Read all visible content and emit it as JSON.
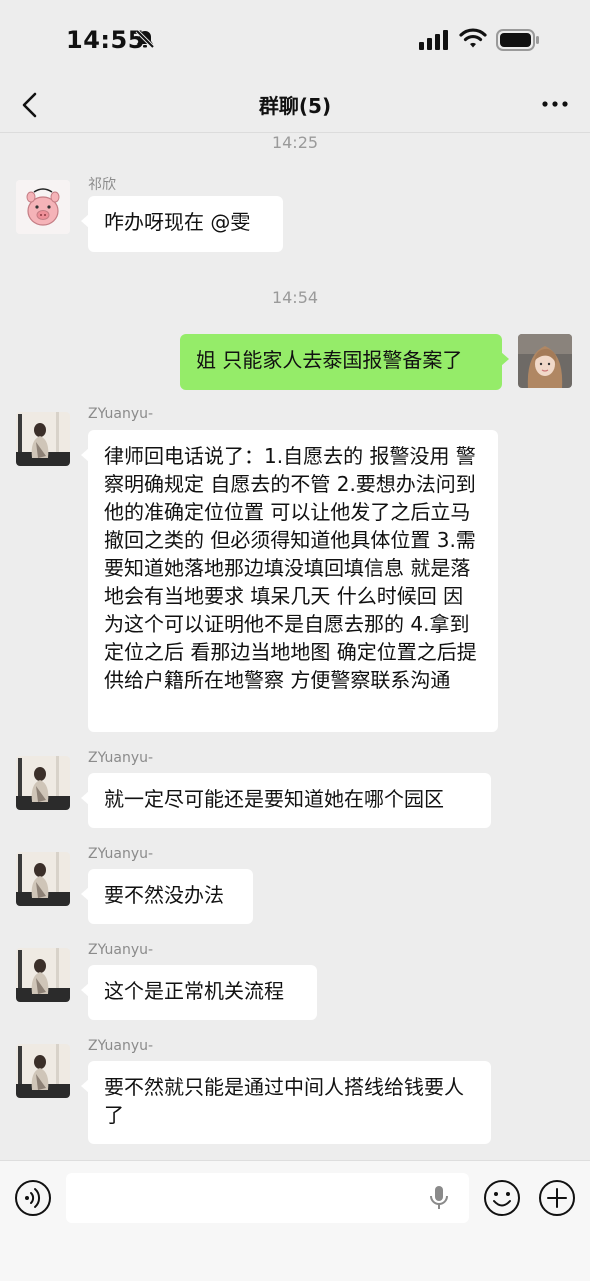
{
  "status": {
    "time": "14:55"
  },
  "nav": {
    "title": "群聊(5)"
  },
  "timestamps": [
    "14:25",
    "14:54"
  ],
  "messages": [
    {
      "sender": "祁欣",
      "text": "咋办呀现在 @雯"
    },
    {
      "sender": "",
      "text": "姐 只能家人去泰国报警备案了"
    },
    {
      "sender": "ZYuanyu-",
      "text": "律师回电话说了：1.自愿去的 报警没用 警察明确规定 自愿去的不管 2.要想办法问到他的准确定位位置 可以让他发了之后立马撤回之类的 但必须得知道他具体位置 3.需要知道她落地那边填没填回填信息 就是落地会有当地要求 填呆几天 什么时候回 因为这个可以证明他不是自愿去那的 4.拿到定位之后 看那边当地地图 确定位置之后提供给户籍所在地警察 方便警察联系沟通"
    },
    {
      "sender": "ZYuanyu-",
      "text": "就一定尽可能还是要知道她在哪个园区"
    },
    {
      "sender": "ZYuanyu-",
      "text": "要不然没办法"
    },
    {
      "sender": "ZYuanyu-",
      "text": "这个是正常机关流程"
    },
    {
      "sender": "ZYuanyu-",
      "text": "要不然就只能是通过中间人搭线给钱要人了"
    }
  ],
  "icons": {
    "status": [
      "bell-off-icon",
      "signal-icon",
      "wifi-icon",
      "battery-icon"
    ],
    "nav": [
      "back-chevron-icon",
      "more-icon"
    ],
    "input": [
      "voice-icon",
      "mic-icon",
      "emoji-icon",
      "plus-icon"
    ]
  },
  "colors": {
    "background": "#ededed",
    "self_bubble": "#95ec69",
    "other_bubble": "#ffffff"
  }
}
